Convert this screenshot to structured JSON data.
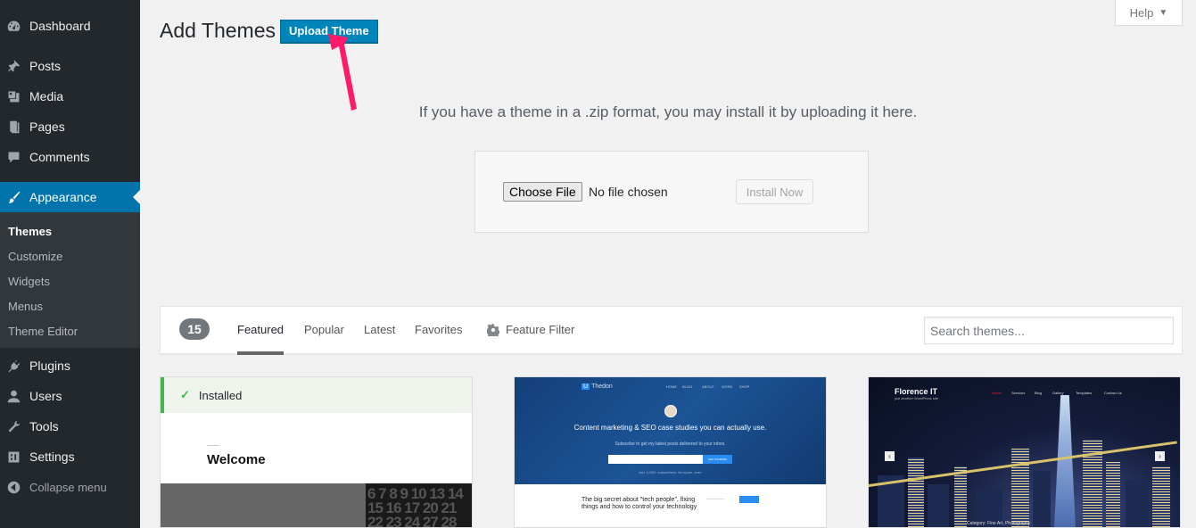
{
  "sidebar": {
    "items": [
      {
        "label": "Dashboard",
        "icon": "dashboard-icon"
      },
      {
        "label": "Posts",
        "icon": "pin-icon"
      },
      {
        "label": "Media",
        "icon": "media-icon"
      },
      {
        "label": "Pages",
        "icon": "pages-icon"
      },
      {
        "label": "Comments",
        "icon": "comment-icon"
      },
      {
        "label": "Appearance",
        "icon": "brush-icon"
      },
      {
        "label": "Plugins",
        "icon": "plug-icon"
      },
      {
        "label": "Users",
        "icon": "user-icon"
      },
      {
        "label": "Tools",
        "icon": "wrench-icon"
      },
      {
        "label": "Settings",
        "icon": "settings-icon"
      },
      {
        "label": "Collapse menu",
        "icon": "collapse-icon"
      }
    ],
    "submenu": [
      "Themes",
      "Customize",
      "Widgets",
      "Menus",
      "Theme Editor"
    ],
    "active_submenu": "Themes"
  },
  "header": {
    "title": "Add Themes",
    "upload_label": "Upload Theme",
    "help_label": "Help"
  },
  "upload": {
    "description": "If you have a theme in a .zip format, you may install it by uploading it here.",
    "choose_file_label": "Choose File",
    "no_file_text": "No file chosen",
    "install_label": "Install Now"
  },
  "filter": {
    "count": "15",
    "tabs": [
      "Featured",
      "Popular",
      "Latest",
      "Favorites"
    ],
    "active_tab": "Featured",
    "feature_filter_label": "Feature Filter",
    "search_placeholder": "Search themes..."
  },
  "themes": [
    {
      "installed_label": "Installed",
      "preview_heading": "Welcome",
      "calendar_text": "6 7 8 9 10 13 14 15 16 17 20 21 22 23 24 27 28"
    },
    {
      "logo_text": "Thedon",
      "nav": [
        "HOME",
        "BLOG",
        "ABOUT",
        "WORK",
        "SHOP"
      ],
      "heading": "Content marketing & SEO case studies you can actually use.",
      "subtext": "Subscribe to get my latest posts delivered to your inbox.",
      "button": "GET STARTED",
      "note": "Join 1,000+ subscribers. No spam, ever.",
      "post_title": "The big secret about \"tech people\", fixing things and how to control your technology",
      "sidebar_button": "SEARCH"
    },
    {
      "title": "Florence IT",
      "tagline": "just another WordPress site",
      "nav": [
        "Home",
        "Services",
        "Blog",
        "Gallery",
        "Templates",
        "Contact Us"
      ],
      "caption": "Category: Fine Art, Photography"
    }
  ],
  "colors": {
    "accent": "#0073aa",
    "upload_button": "#0085ba",
    "installed": "#46b450",
    "annotation_arrow": "#ff1a6c"
  }
}
